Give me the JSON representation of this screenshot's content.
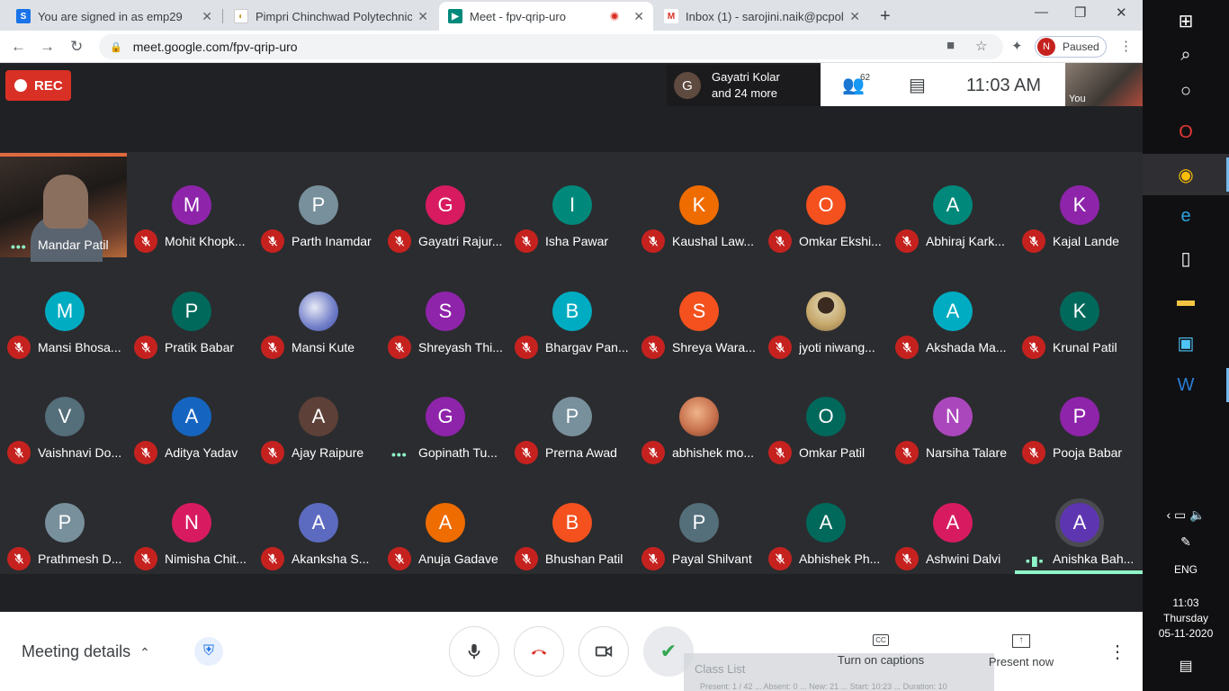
{
  "browser": {
    "tabs": [
      {
        "title": "You are signed in as emp29",
        "fav_color": "#1a73e8",
        "fav_text": "S"
      },
      {
        "title": "Pimpri Chinchwad Polytechnic",
        "fav_color": "#ffffff",
        "fav_text": "◐"
      },
      {
        "title": "Meet - fpv-qrip-uro",
        "fav_color": "#00897b",
        "fav_text": "▶"
      },
      {
        "title": "Inbox (1) - sarojini.naik@pcpolyte",
        "fav_color": "#ffffff",
        "fav_text": "M"
      }
    ],
    "url": "meet.google.com/fpv-qrip-uro",
    "profile_initial": "N",
    "profile_status": "Paused"
  },
  "meet": {
    "rec_label": "REC",
    "presenter_initial": "G",
    "presenter_line1": "Gayatri Kolar",
    "presenter_line2": "and 24 more",
    "people_count": "62",
    "time": "11:03  AM",
    "self_label": "You",
    "featured": {
      "name": "Mandar Patil"
    },
    "participants": [
      {
        "name": "Mohit Khopk...",
        "initial": "M",
        "color": "#8e24aa"
      },
      {
        "name": "Parth Inamdar",
        "initial": "P",
        "color": "#78909c"
      },
      {
        "name": "Gayatri Rajur...",
        "initial": "G",
        "color": "#d81b60"
      },
      {
        "name": "Isha Pawar",
        "initial": "I",
        "color": "#00897b"
      },
      {
        "name": "Kaushal Law...",
        "initial": "K",
        "color": "#ef6c00"
      },
      {
        "name": "Omkar Ekshi...",
        "initial": "O",
        "color": "#f4511e"
      },
      {
        "name": "Abhiraj Kark...",
        "initial": "A",
        "color": "#00897b"
      },
      {
        "name": "Kajal Lande",
        "initial": "K",
        "color": "#8e24aa"
      },
      {
        "name": "Mansi Bhosa...",
        "initial": "M",
        "color": "#00acc1"
      },
      {
        "name": "Pratik Babar",
        "initial": "P",
        "color": "#00695c"
      },
      {
        "name": "Mansi Kute",
        "initial": "",
        "color": "#9fa8da"
      },
      {
        "name": "Shreyash Thi...",
        "initial": "S",
        "color": "#8e24aa"
      },
      {
        "name": "Bhargav Pan...",
        "initial": "B",
        "color": "#00acc1"
      },
      {
        "name": "Shreya Wara...",
        "initial": "S",
        "color": "#f4511e"
      },
      {
        "name": "jyoti niwang...",
        "initial": "",
        "color": "#b39867"
      },
      {
        "name": "Akshada Ma...",
        "initial": "A",
        "color": "#00acc1"
      },
      {
        "name": "Krunal Patil",
        "initial": "K",
        "color": "#00695c"
      },
      {
        "name": "Vaishnavi Do...",
        "initial": "V",
        "color": "#546e7a"
      },
      {
        "name": "Aditya Yadav",
        "initial": "A",
        "color": "#1565c0"
      },
      {
        "name": "Ajay Raipure",
        "initial": "A",
        "color": "#5d4037"
      },
      {
        "name": "Gopinath Tu...",
        "initial": "G",
        "color": "#8e24aa"
      },
      {
        "name": "Prerna Awad",
        "initial": "P",
        "color": "#78909c"
      },
      {
        "name": "abhishek mo...",
        "initial": "",
        "color": "#c8734f"
      },
      {
        "name": "Omkar Patil",
        "initial": "O",
        "color": "#00695c"
      },
      {
        "name": "Narsiha Talare",
        "initial": "N",
        "color": "#ab47bc"
      },
      {
        "name": "Pooja Babar",
        "initial": "P",
        "color": "#8e24aa"
      },
      {
        "name": "Prathmesh D...",
        "initial": "P",
        "color": "#78909c"
      },
      {
        "name": "Nimisha Chit...",
        "initial": "N",
        "color": "#d81b60"
      },
      {
        "name": "Akanksha S...",
        "initial": "A",
        "color": "#5c6bc0"
      },
      {
        "name": "Anuja Gadave",
        "initial": "A",
        "color": "#ef6c00"
      },
      {
        "name": "Bhushan Patil",
        "initial": "B",
        "color": "#f4511e"
      },
      {
        "name": "Payal Shilvant",
        "initial": "P",
        "color": "#546e7a"
      },
      {
        "name": "Abhishek Ph...",
        "initial": "A",
        "color": "#00695c"
      },
      {
        "name": "Ashwini Dalvi",
        "initial": "A",
        "color": "#d81b60"
      },
      {
        "name": "Anishka Bah...",
        "initial": "A",
        "color": "#5e35b1"
      }
    ]
  },
  "controls": {
    "meeting_details": "Meeting details",
    "class_list": "Class List",
    "class_list_info": "Present: 1 / 42 ... Absent: 0 ... New: 21 ... Start: 10:23 ... Duration: 10",
    "captions": "Turn on captions",
    "captions_icon": "CC",
    "present_now": "Present now"
  },
  "taskbar": {
    "lang": "ENG",
    "time": "11:03",
    "day": "Thursday",
    "date": "05-11-2020"
  }
}
